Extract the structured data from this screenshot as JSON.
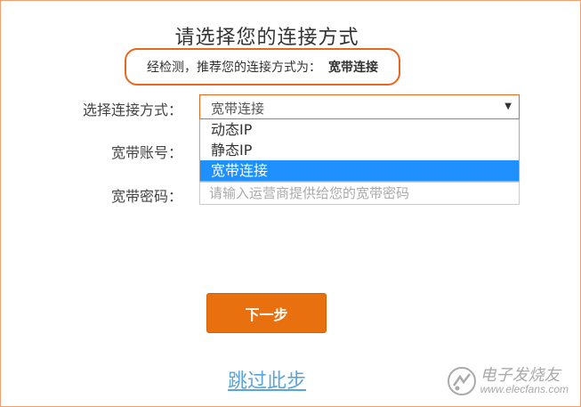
{
  "page": {
    "title": "请选择您的连接方式",
    "recommend_prefix": "经检测，推荐您的连接方式为：",
    "recommend_method": "宽带连接"
  },
  "form": {
    "method_label": "选择连接方式：",
    "method_value": "宽带连接",
    "method_options": [
      "动态IP",
      "静态IP",
      "宽带连接"
    ],
    "account_label": "宽带账号：",
    "password_label": "宽带密码：",
    "password_placeholder": "请输入运营商提供给您的宽带密码"
  },
  "actions": {
    "next_label": "下一步",
    "skip_label": "跳过此步"
  },
  "watermark": {
    "brand": "电子发烧友",
    "site": "www.elecfans.com"
  },
  "colors": {
    "accent": "#e8700f",
    "selected_option": "#1e90ff",
    "link": "#5aa5da"
  }
}
